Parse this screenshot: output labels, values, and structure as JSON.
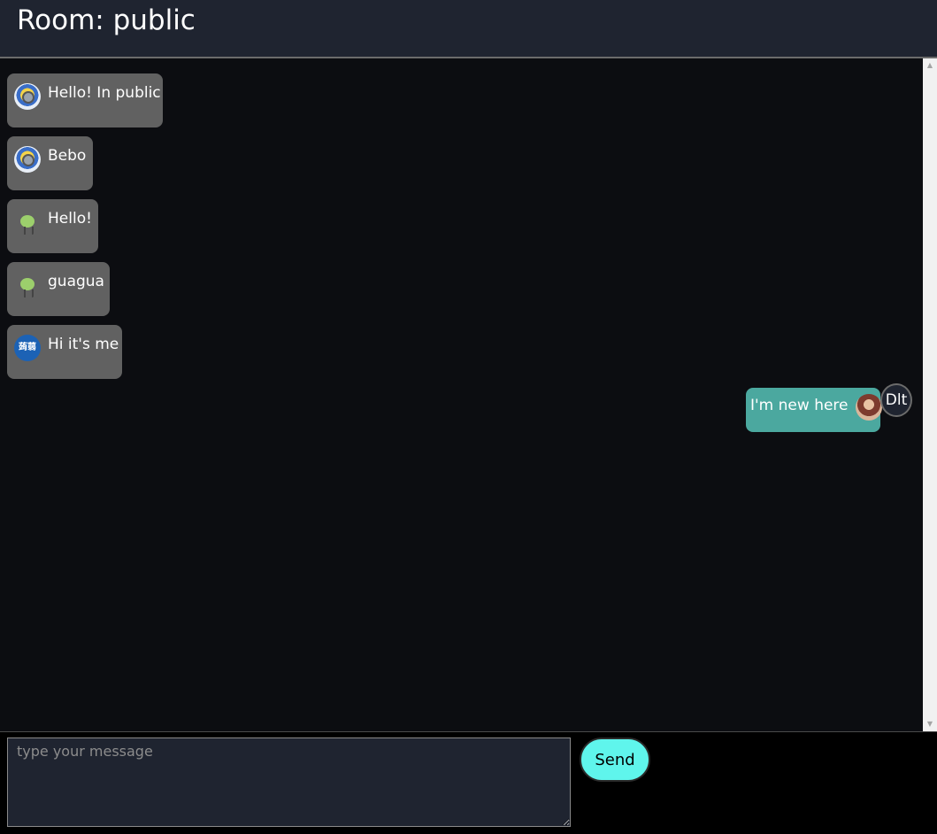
{
  "room": {
    "title": "Room: public"
  },
  "messages": [
    {
      "direction": "in",
      "avatar": "minion-avatar",
      "text": "Hello! In public"
    },
    {
      "direction": "in",
      "avatar": "minion-avatar",
      "text": "Bebo"
    },
    {
      "direction": "in",
      "avatar": "green-creature-avatar",
      "text": "Hello!"
    },
    {
      "direction": "in",
      "avatar": "green-creature-avatar",
      "text": "guagua"
    },
    {
      "direction": "in",
      "avatar": "blue-badge-avatar",
      "avatar_text": "蒟蒻",
      "text": "Hi it's me"
    },
    {
      "direction": "out",
      "avatar": "photo-avatar",
      "text": "I'm new here",
      "delete_label": "Dlt"
    }
  ],
  "composer": {
    "placeholder": "type your message",
    "value": "",
    "send_label": "Send"
  },
  "colors": {
    "header_bg": "#1f2430",
    "chat_bg": "#0c0d11",
    "incoming_bubble": "#616161",
    "outgoing_bubble": "#4ba89f",
    "send_button": "#5ff5ec"
  }
}
